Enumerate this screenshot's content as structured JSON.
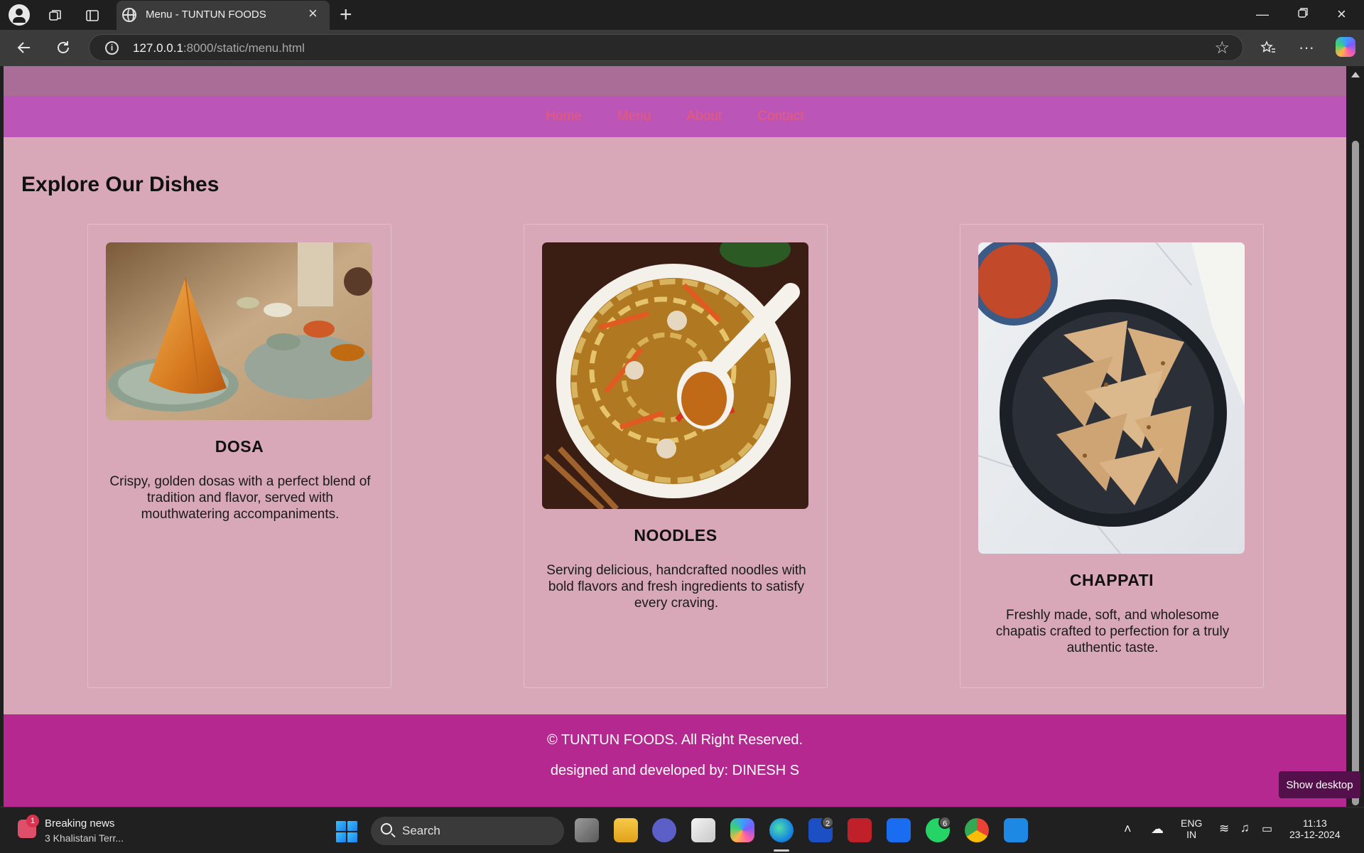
{
  "browser": {
    "tab_title": "Menu - TUNTUN FOODS",
    "url_host": "127.0.0.1",
    "url_rest": ":8000/static/menu.html"
  },
  "site": {
    "nav": [
      "Home",
      "Menu",
      "About",
      "Contact"
    ],
    "heading": "Explore Our Dishes",
    "dishes": [
      {
        "name": "DOSA",
        "description": "Crispy, golden dosas with a perfect blend of tradition and flavor, served with mouthwatering accompaniments."
      },
      {
        "name": "NOODLES",
        "description": "Serving delicious, handcrafted noodles with bold flavors and fresh ingredients to satisfy every craving."
      },
      {
        "name": "CHAPPATI",
        "description": "Freshly made, soft, and wholesome chapatis crafted to perfection for a truly authentic taste."
      }
    ],
    "footer": {
      "copyright": "© TUNTUN FOODS. All Right Reserved.",
      "credit": "designed and developed by: DINESH S"
    }
  },
  "overlay": {
    "show_desktop": "Show desktop"
  },
  "taskbar": {
    "news_badge": "1",
    "news_title": "Breaking news",
    "news_subtitle": "3 Khalistani Terr...",
    "search_label": "Search",
    "l_badge": "2",
    "whatsapp_badge": "6",
    "language_top": "ENG",
    "language_bottom": "IN",
    "time": "11:13",
    "date": "23-12-2024"
  },
  "colors": {
    "page_bg": "#d8a8b8",
    "nav_bg": "#bc55b8",
    "nav_link": "#e85a74",
    "footer_bg": "#b4288f"
  }
}
